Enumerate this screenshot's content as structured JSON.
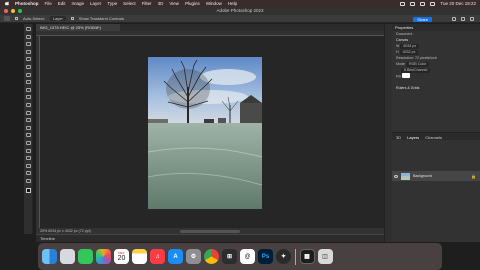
{
  "menubar": {
    "items": [
      "Photoshop",
      "File",
      "Edit",
      "Image",
      "Layer",
      "Type",
      "Select",
      "Filter",
      "3D",
      "View",
      "Plugins",
      "Window",
      "Help"
    ],
    "datetime": "Tue 20 Dec 19:22"
  },
  "window": {
    "title": "Adobe Photoshop 2023"
  },
  "options": {
    "auto_select": "Auto-Select:",
    "auto_select_value": "Layer",
    "show_transform": "Show Transform Controls",
    "share": "Share"
  },
  "document": {
    "tab_label": "IMG_1378.HEIC @ 25% (RGB/8*)",
    "status": "25%   6034 px x 4032 px (72 ppi)"
  },
  "timeline": {
    "label": "Timeline"
  },
  "properties": {
    "header": "Properties",
    "doc_label": "Document",
    "canvas_section": "Canvas",
    "width": "6034 px",
    "height": "4032 px",
    "resolution": "Resolution: 72 pixels/inch",
    "mode_label": "Mode",
    "mode_value": "RGB Color",
    "depth_value": "8 Bits/Channel",
    "fill_label": "Fill",
    "rulers_section": "Rulers & Grids"
  },
  "layers": {
    "tabs": [
      "3D",
      "Layers",
      "Channels"
    ],
    "active_tab": "Layers",
    "items": [
      {
        "name": "Background"
      }
    ]
  },
  "dock": {
    "calendar_month": "DEC",
    "calendar_day": "20",
    "apps": [
      "finder-icon",
      "launchpad-icon",
      "messages-icon",
      "photos-icon",
      "calendar-icon",
      "notes-icon",
      "music-icon",
      "app-store-icon",
      "system-settings-icon",
      "chrome-icon",
      "calculator-icon",
      "mail-icon",
      "photoshop-icon",
      "safari-icon",
      "activity-monitor-icon",
      "trash-icon"
    ]
  },
  "colors": {
    "share": "#1473e6",
    "panel_bg": "#323232",
    "canvas_bg": "#262626"
  }
}
